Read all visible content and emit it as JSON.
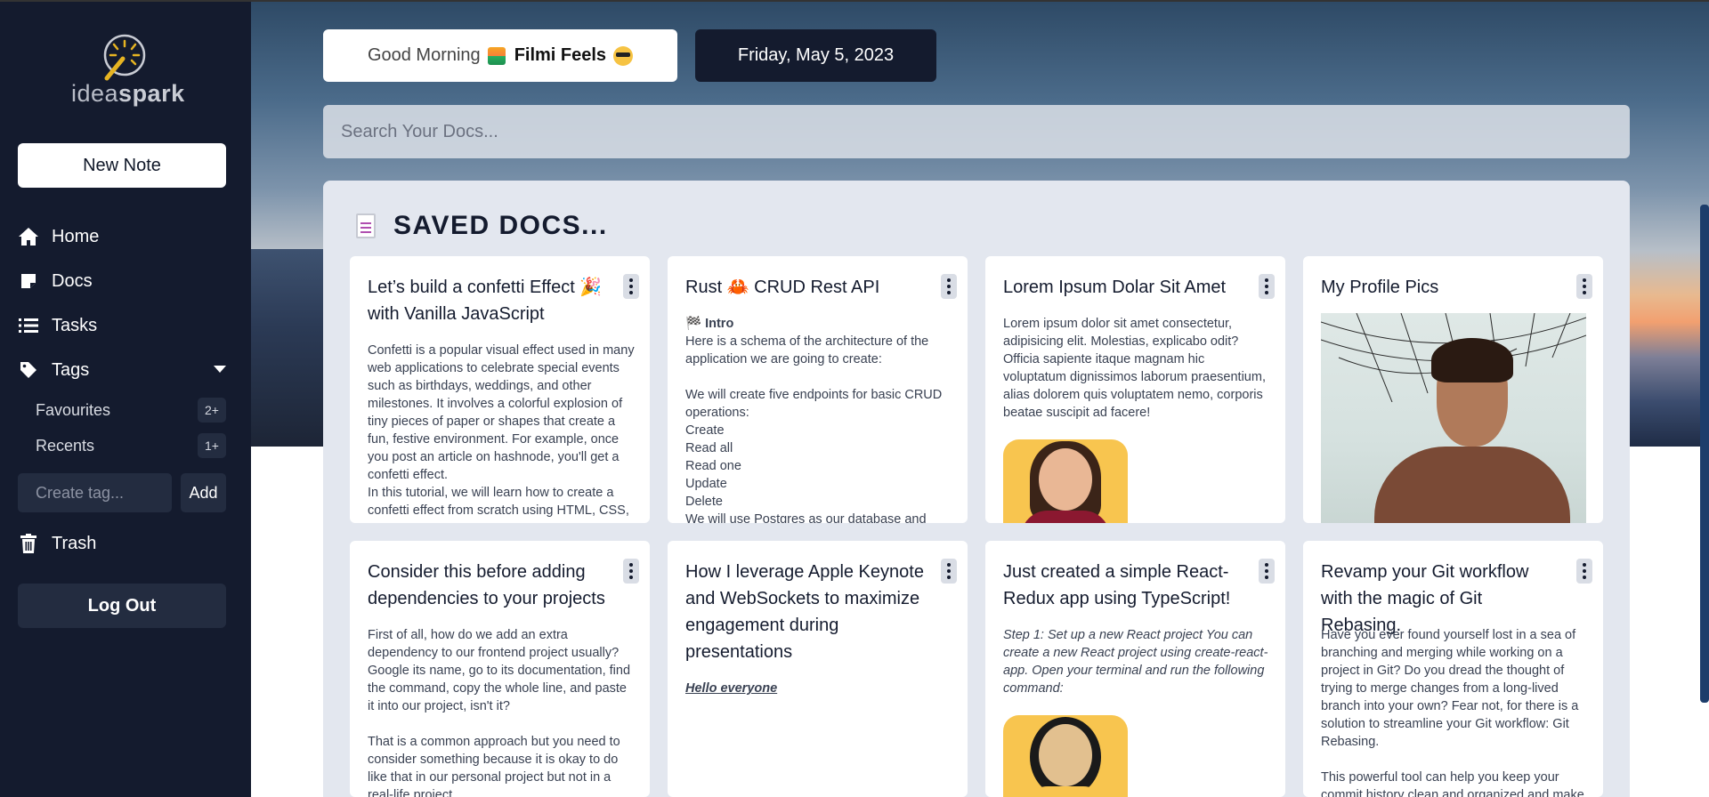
{
  "brand": {
    "logo_light": "idea",
    "logo_bold": "spark"
  },
  "sidebar": {
    "new_note": "New Note",
    "nav": [
      {
        "label": "Home",
        "icon": "home-icon"
      },
      {
        "label": "Docs",
        "icon": "note-icon"
      },
      {
        "label": "Tasks",
        "icon": "list-icon"
      },
      {
        "label": "Tags",
        "icon": "tag-icon"
      }
    ],
    "tags": [
      {
        "label": "Favourites",
        "count": "2+"
      },
      {
        "label": "Recents",
        "count": "1+"
      }
    ],
    "tag_input_placeholder": "Create tag...",
    "tag_add": "Add",
    "trash": "Trash",
    "logout": "Log Out"
  },
  "header": {
    "greeting": "Good Morning",
    "name": "Filmi Feels",
    "date": "Friday, May 5, 2023"
  },
  "search": {
    "placeholder": "Search Your Docs..."
  },
  "saved": {
    "title": "SAVED DOCS...",
    "cards": [
      {
        "title": "Let’s build a confetti Effect 🎉 with Vanilla JavaScript",
        "body": "Confetti is a popular visual effect used in many web applications to celebrate special events such as birthdays, weddings, and other milestones. It involves a colorful explosion of tiny pieces of paper or shapes that create a fun, festive environment. For example, once you post an article on hashnode, you'll get a confetti effect.\nIn this tutorial, we will learn how to create a confetti effect from scratch using HTML, CSS,"
      },
      {
        "title": "Rust 🦀 CRUD Rest API",
        "intro": "🏁 Intro",
        "body": "Here is a schema of the architecture of the application we are going to create:\n\nWe will create five endpoints for basic CRUD operations:\nCreate\nRead all\nRead one\nUpdate\nDelete\nWe will use Postgres as our database and"
      },
      {
        "title": "Lorem Ipsum Dolar Sit Amet",
        "body": "Lorem ipsum dolor sit amet consectetur, adipisicing elit. Molestias, explicabo odit? Officia sapiente itaque magnam hic voluptatum dignissimos laborum praesentium, alias dolorem quis voluptatem nemo, corporis beatae suscipit ad facere!"
      },
      {
        "title": "My Profile Pics"
      },
      {
        "title": "Consider this before adding dependencies to your projects",
        "body": "First of all, how do we add an extra dependency to our frontend project usually? Google its name, go to its documentation, find the command, copy the whole line, and paste it into our project, isn't it?\n\nThat is a common approach but you need to consider something because it is okay to do like that in our personal project but not in a real-life project."
      },
      {
        "title": "How I leverage Apple Keynote and WebSockets to maximize engagement during presentations",
        "body": "Hello everyone"
      },
      {
        "title": "Just created a simple React-Redux app using TypeScript!",
        "body": "Step 1: Set up a new React project You can create a new React project using create-react-app. Open your terminal and run the following command:"
      },
      {
        "title": "Revamp your Git workflow with the magic of Git Rebasing.",
        "body": "Have you ever found yourself lost in a sea of branching and merging while working on a project in Git? Do you dread the thought of trying to merge changes from a long-lived branch into your own? Fear not, for there is a solution to streamline your Git workflow: Git Rebasing.\n\nThis powerful tool can help you keep your commit history clean and organized and make"
      }
    ]
  }
}
